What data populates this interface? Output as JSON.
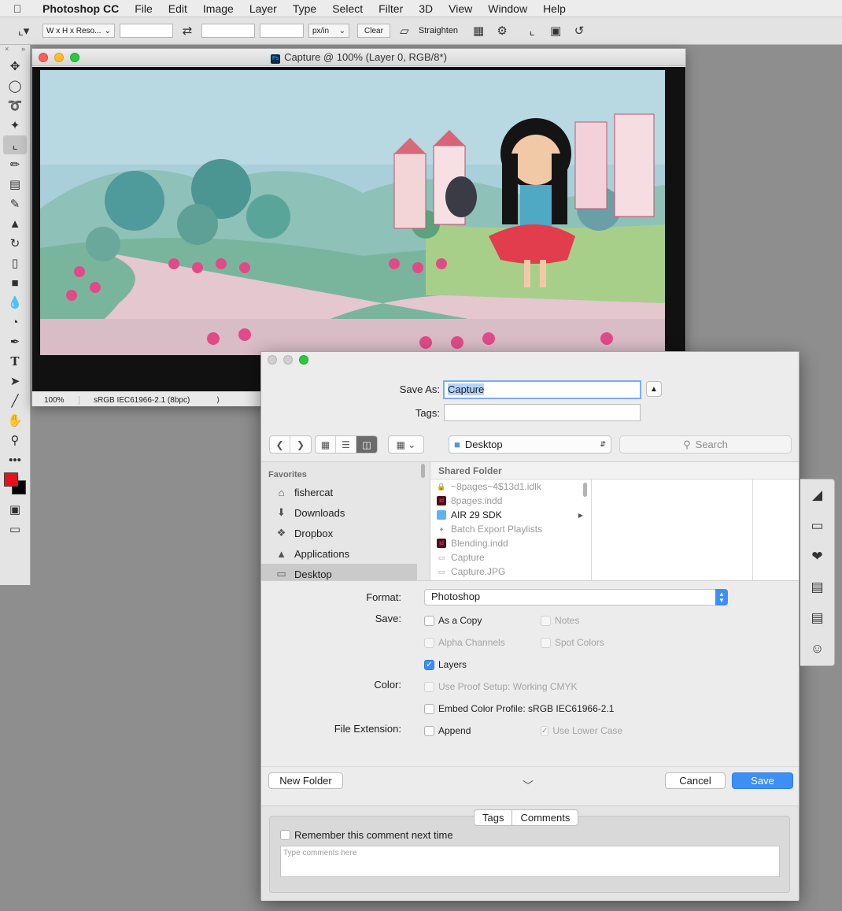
{
  "menubar": {
    "app_name": "Photoshop CC",
    "items": [
      "File",
      "Edit",
      "Image",
      "Layer",
      "Type",
      "Select",
      "Filter",
      "3D",
      "View",
      "Window",
      "Help"
    ]
  },
  "options_bar": {
    "ratio_preset": "W x H x Reso...",
    "resolution_unit": "px/in",
    "clear_label": "Clear",
    "straighten_label": "Straighten"
  },
  "toolbox": {
    "tools": [
      "move-tool",
      "marquee-tool",
      "lasso-tool",
      "magic-wand-tool",
      "crop-tool",
      "eyedropper-tool",
      "healing-tool",
      "brush-tool",
      "stamp-tool",
      "history-brush-tool",
      "eraser-tool",
      "gradient-tool",
      "blur-tool",
      "dodge-tool",
      "pen-tool",
      "type-tool",
      "path-select-tool",
      "line-tool",
      "hand-tool",
      "zoom-tool",
      "more-tools"
    ],
    "foreground_color": "#e8101c",
    "background_color": "#000000"
  },
  "document": {
    "title": "Capture @ 100% (Layer 0, RGB/8*)",
    "zoom": "100%",
    "profile": "sRGB IEC61966-2.1 (8bpc)"
  },
  "save_dialog": {
    "save_as_label": "Save As:",
    "save_as_value": "Capture",
    "tags_label": "Tags:",
    "location": "Desktop",
    "search_placeholder": "Search",
    "favorites_header": "Favorites",
    "favorites": [
      {
        "label": "fishercat",
        "icon": "home-icon"
      },
      {
        "label": "Downloads",
        "icon": "download-icon"
      },
      {
        "label": "Dropbox",
        "icon": "dropbox-icon"
      },
      {
        "label": "Applications",
        "icon": "applications-icon"
      },
      {
        "label": "Desktop",
        "icon": "desktop-icon"
      }
    ],
    "column_header": "Shared Folder",
    "files": [
      {
        "name": "~8pages~4$13d1.idlk",
        "icon": "lock-icon",
        "enabled": false
      },
      {
        "name": "8pages.indd",
        "icon": "indesign-file-icon",
        "enabled": false
      },
      {
        "name": "AIR 29 SDK",
        "icon": "folder-icon",
        "enabled": true
      },
      {
        "name": "Batch Export Playlists",
        "icon": "playlist-icon",
        "enabled": false
      },
      {
        "name": "Blending.indd",
        "icon": "indesign-file-icon",
        "enabled": false
      },
      {
        "name": "Capture",
        "icon": "document-icon",
        "enabled": false
      },
      {
        "name": "Capture.JPG",
        "icon": "image-file-icon",
        "enabled": false
      }
    ],
    "format_label": "Format:",
    "format_value": "Photoshop",
    "save_label": "Save:",
    "color_label": "Color:",
    "file_extension_label": "File Extension:",
    "options": {
      "as_a_copy": "As a Copy",
      "notes": "Notes",
      "alpha_channels": "Alpha Channels",
      "spot_colors": "Spot Colors",
      "layers": "Layers",
      "use_proof_setup": "Use Proof Setup:  Working CMYK",
      "embed_color_profile": "Embed Color Profile:  sRGB IEC61966-2.1",
      "append": "Append",
      "use_lower_case": "Use Lower Case"
    },
    "new_folder": "New Folder",
    "cancel": "Cancel",
    "save": "Save",
    "tabs": [
      "Tags",
      "Comments"
    ],
    "remember_comment": "Remember this comment next time",
    "comment_placeholder": "Type comments here"
  },
  "right_panel": {
    "icons": [
      "libraries-icon",
      "desktop-display-icon",
      "favorites-heart-icon",
      "recent-folder-icon",
      "recent-document-icon",
      "finder-icon"
    ]
  },
  "colors": {
    "accent": "#3d8ef5",
    "selection_bg": "#b4d4fb"
  }
}
